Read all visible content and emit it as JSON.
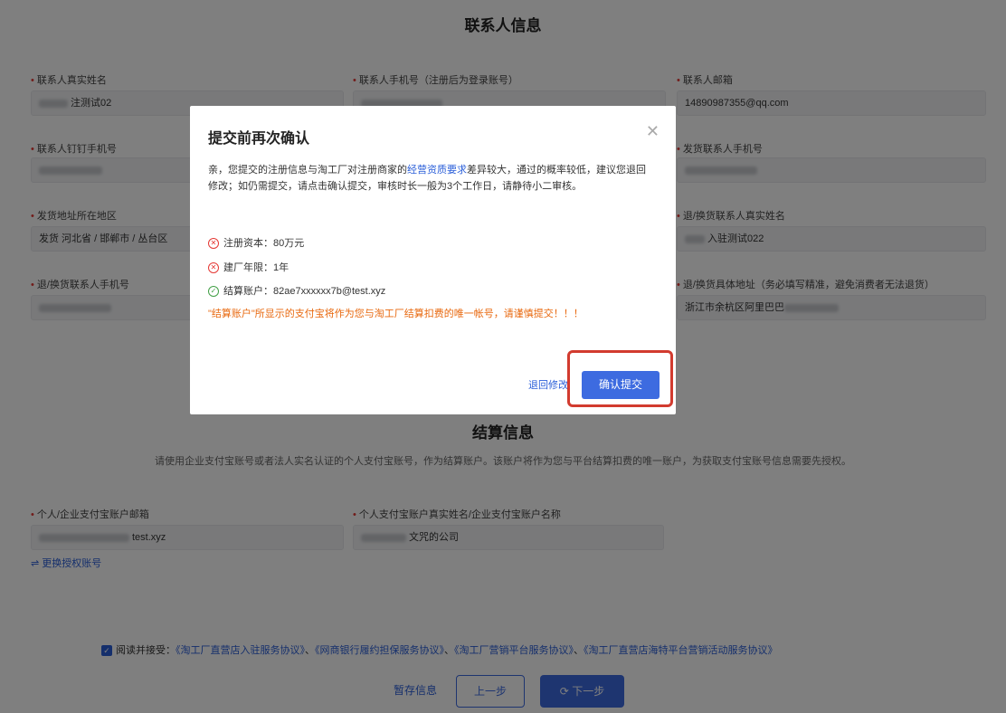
{
  "contact_section": {
    "title": "联系人信息",
    "real_name": {
      "label": "联系人真实姓名",
      "value": "注测试02"
    },
    "phone": {
      "label": "联系人手机号（注册后为登录账号）"
    },
    "email": {
      "label": "联系人邮箱",
      "value": "14890987355@qq.com"
    },
    "dingtalk": {
      "label": "联系人钉钉手机号"
    },
    "ship_phone": {
      "label": "发货联系人手机号"
    },
    "ship_region": {
      "label": "发货地址所在地区",
      "value": "发货 河北省 / 邯郸市 / 丛台区"
    },
    "return_name": {
      "label": "退/换货联系人真实姓名",
      "value": "入驻测试022"
    },
    "return_phone": {
      "label": "退/换货联系人手机号"
    },
    "return_address": {
      "label": "退/换货具体地址（务必填写精准，避免消费者无法退货）",
      "value": "浙江市余杭区阿里巴巴"
    }
  },
  "settlement_section": {
    "title": "结算信息",
    "hint": "请使用企业支付宝账号或者法人实名认证的个人支付宝账号，作为结算账户。该账户将作为您与平台结算扣费的唯一账户，为获取支付宝账号信息需要先授权。",
    "alipay_email": {
      "label": "个人/企业支付宝账户邮箱",
      "value": "test.xyz"
    },
    "alipay_name": {
      "label": "个人支付宝账户真实姓名/企业支付宝账户名称",
      "value": "文咒的公司"
    },
    "switch_link": "⇌ 更换授权账号"
  },
  "agreement": {
    "prefix": "阅读并接受：",
    "links": [
      "《淘工厂直营店入驻服务协议》",
      "《网商银行履约担保服务协议》",
      "《淘工厂营销平台服务协议》",
      "《淘工厂直营店海特平台营销活动服务协议》"
    ],
    "separator": "、"
  },
  "footer": {
    "save_label": "暂存信息",
    "prev_label": "上一步",
    "next_label": "下一步"
  },
  "modal": {
    "title": "提交前再次确认",
    "body_pre": "亲，您提交的注册信息与淘工厂对注册商家的",
    "body_link": "经营资质要求",
    "body_post": "差异较大，通过的概率较低，建议您退回修改；如仍需提交，请点击确认提交，审核时长一般为3个工作日，请静待小二审核。",
    "items": [
      {
        "status": "fail",
        "icon": "error-circle-icon",
        "text": "注册资本：80万元"
      },
      {
        "status": "fail",
        "icon": "error-circle-icon",
        "text": "建厂年限：1年"
      },
      {
        "status": "pass",
        "icon": "check-circle-icon",
        "text": "结算账户：82ae7xxxxxx7b@test.xyz"
      }
    ],
    "warning": "\"结算账户\"所显示的支付宝将作为您与淘工厂结算扣费的唯一帐号，请谨慎提交！！！",
    "back_label": "退回修改",
    "confirm_label": "确认提交"
  },
  "colors": {
    "accent": "#3d6be0",
    "link": "#2b5fd9",
    "warning": "#e8680e",
    "error": "#e53935",
    "success": "#43a047",
    "highlight": "#d23b2f"
  }
}
